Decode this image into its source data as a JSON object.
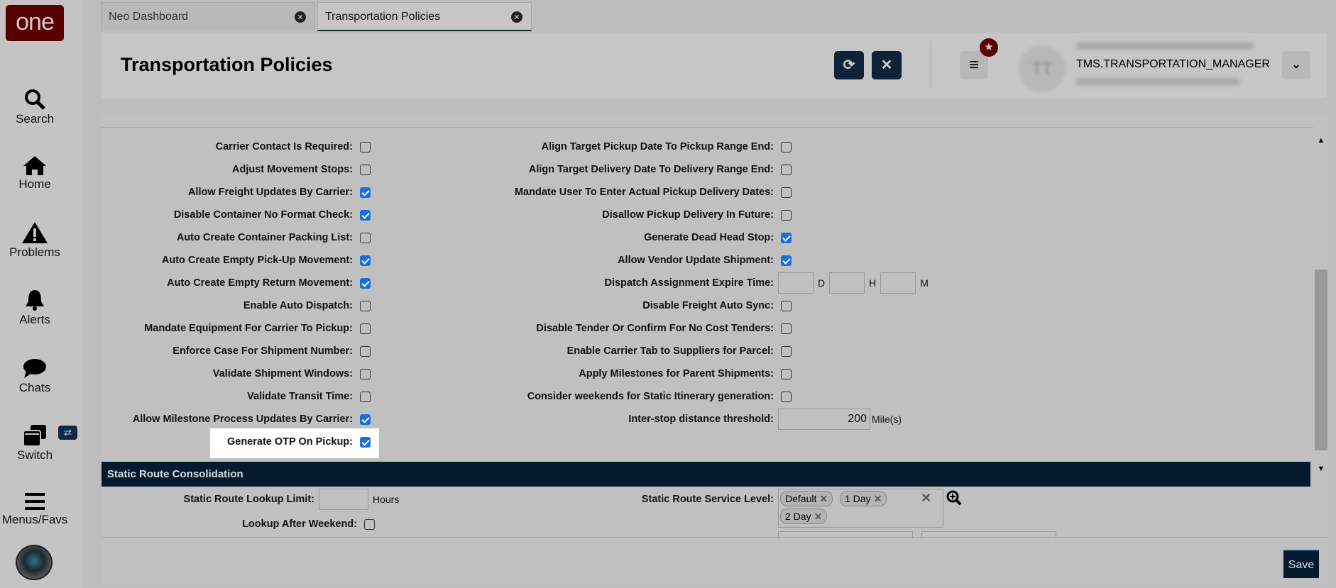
{
  "sidebar": {
    "logo": "one",
    "items": [
      {
        "label": "Search",
        "icon": "search-icon"
      },
      {
        "label": "Home",
        "icon": "home-icon"
      },
      {
        "label": "Problems",
        "icon": "warning-icon"
      },
      {
        "label": "Alerts",
        "icon": "bell-icon"
      },
      {
        "label": "Chats",
        "icon": "chat-icon"
      },
      {
        "label": "Switch",
        "icon": "windows-icon"
      },
      {
        "label": "Menus/Favs",
        "icon": "menu-icon"
      }
    ],
    "switch_badge": "⇄"
  },
  "tabs": [
    {
      "label": "Neo Dashboard"
    },
    {
      "label": "Transportation Policies"
    }
  ],
  "header": {
    "title": "Transportation Policies",
    "user_role": "TMS.TRANSPORTATION_MANAGER",
    "avatar_initials": "TT"
  },
  "left_fields": [
    {
      "label": "Carrier Contact Is Required:",
      "checked": false
    },
    {
      "label": "Adjust Movement Stops:",
      "checked": false
    },
    {
      "label": "Allow Freight Updates By Carrier:",
      "checked": true
    },
    {
      "label": "Disable Container No Format Check:",
      "checked": true
    },
    {
      "label": "Auto Create Container Packing List:",
      "checked": false
    },
    {
      "label": "Auto Create Empty Pick-Up Movement:",
      "checked": true
    },
    {
      "label": "Auto Create Empty Return Movement:",
      "checked": true
    },
    {
      "label": "Enable Auto Dispatch:",
      "checked": false
    },
    {
      "label": "Mandate Equipment For Carrier To Pickup:",
      "checked": false
    },
    {
      "label": "Enforce Case For Shipment Number:",
      "checked": false
    },
    {
      "label": "Validate Shipment Windows:",
      "checked": false
    },
    {
      "label": "Validate Transit Time:",
      "checked": false
    },
    {
      "label": "Allow Milestone Process Updates By Carrier:",
      "checked": true
    },
    {
      "label": "Generate OTP On Pickup:",
      "checked": true
    }
  ],
  "right_fields": [
    {
      "label": "Align Target Pickup Date To Pickup Range End:",
      "checked": false
    },
    {
      "label": "Align Target Delivery Date To Delivery Range End:",
      "checked": false
    },
    {
      "label": "Mandate User To Enter Actual Pickup Delivery Dates:",
      "checked": false
    },
    {
      "label": "Disallow Pickup Delivery In Future:",
      "checked": false
    },
    {
      "label": "Generate Dead Head Stop:",
      "checked": true
    },
    {
      "label": "Allow Vendor Update Shipment:",
      "checked": true
    },
    {
      "label": "Dispatch Assignment Expire Time:",
      "type": "dhm",
      "units": [
        "D",
        "H",
        "M"
      ]
    },
    {
      "label": "Disable Freight Auto Sync:",
      "checked": false
    },
    {
      "label": "Disable Tender Or Confirm For No Cost Tenders:",
      "checked": false
    },
    {
      "label": "Enable Carrier Tab to Suppliers for Parcel:",
      "checked": false
    },
    {
      "label": "Apply Milestones for Parent Shipments:",
      "checked": false
    },
    {
      "label": "Consider weekends for Static Itinerary generation:",
      "checked": false
    },
    {
      "label": "Inter-stop distance threshold:",
      "type": "number",
      "value": "200",
      "unit": "Mile(s)"
    }
  ],
  "static_route": {
    "title": "Static Route Consolidation",
    "lookup_limit_label": "Static Route Lookup Limit:",
    "lookup_limit_unit": "Hours",
    "lookup_weekend_label": "Lookup After Weekend:",
    "service_level_label": "Static Route Service Level:",
    "service_levels": [
      "Default",
      "1 Day",
      "2 Day"
    ]
  },
  "footer": {
    "save": "Save"
  }
}
